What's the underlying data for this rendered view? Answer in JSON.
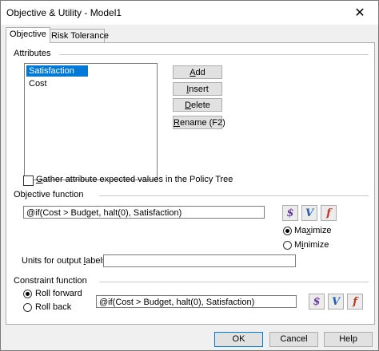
{
  "window": {
    "title": "Objective & Utility - Model1",
    "close_glyph": "✕"
  },
  "tabs": [
    {
      "label": "Objective",
      "active": true
    },
    {
      "label": "Risk Tolerance",
      "active": false
    }
  ],
  "attributes": {
    "section_label": "Attributes",
    "items": [
      "Satisfaction",
      "Cost"
    ],
    "selected": "Satisfaction",
    "buttons": {
      "add": {
        "first": "A",
        "rest": "dd"
      },
      "insert": {
        "first": "I",
        "rest": "nsert"
      },
      "delete": {
        "first": "D",
        "rest": "elete"
      },
      "rename": {
        "first": "R",
        "rest": "ename (F2)"
      }
    },
    "gather_checkbox": {
      "first": "G",
      "rest": "ather attribute expected values in the Policy Tree",
      "checked": false
    }
  },
  "objective": {
    "section_label": "Objective function",
    "formula": "@if(Cost > Budget, halt(0), Satisfaction)",
    "maximize": {
      "pre": "Ma",
      "key": "x",
      "post": "imize",
      "checked": true
    },
    "minimize": {
      "pre": "M",
      "key": "i",
      "post": "nimize",
      "checked": false
    },
    "units_label": {
      "pre": "Units for output ",
      "key": "l",
      "post": "abels:"
    },
    "units_value": ""
  },
  "constraint": {
    "section_label": "Constraint function",
    "roll_forward": {
      "label": "Roll forward",
      "checked": true
    },
    "roll_back": {
      "label": "Roll back",
      "checked": false
    },
    "formula": "@if(Cost > Budget, halt(0), Satisfaction)"
  },
  "icon_buttons": {
    "dollar": "$",
    "value": "V",
    "function": "f"
  },
  "footer": {
    "ok": "OK",
    "cancel": "Cancel",
    "help": "Help"
  }
}
